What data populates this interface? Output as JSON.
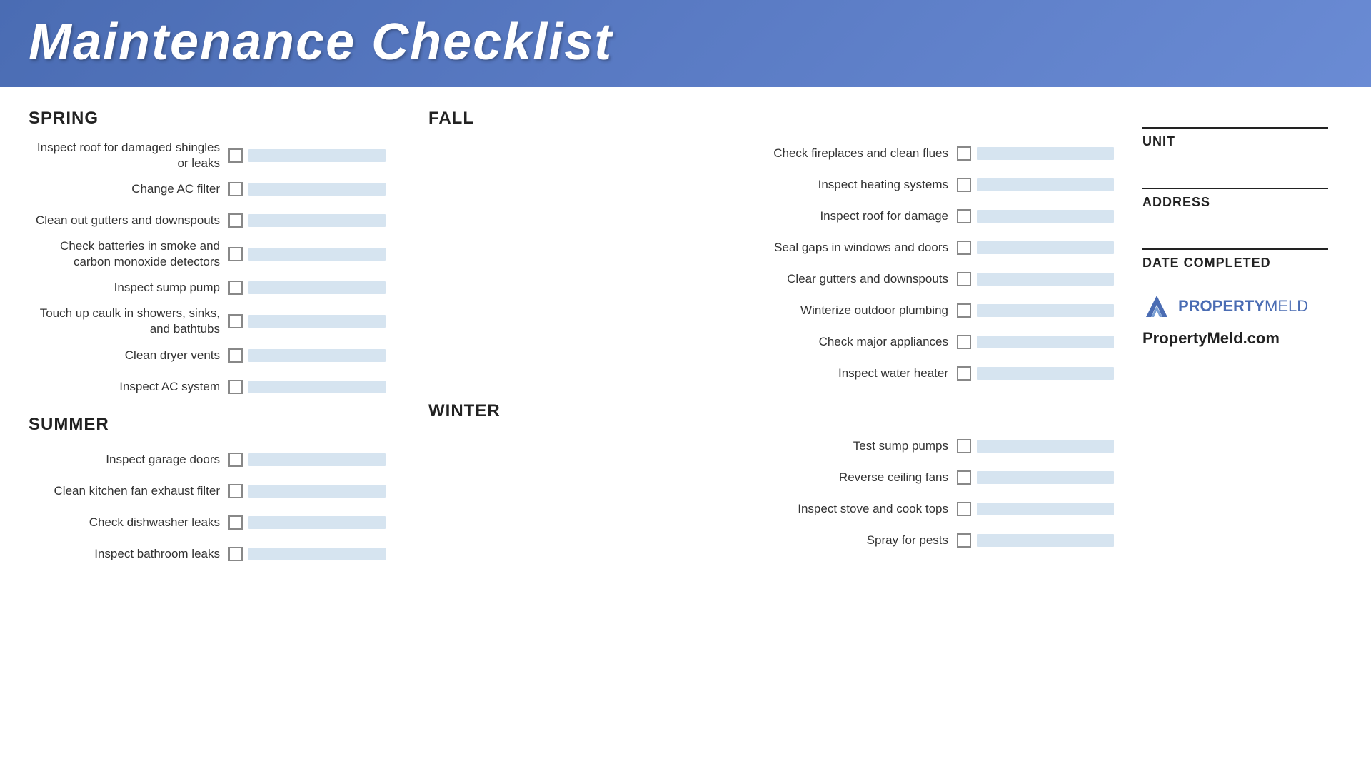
{
  "header": {
    "title": "Maintenance Checklist"
  },
  "spring": {
    "section_title": "SPRING",
    "items": [
      "Inspect roof for damaged shingles or leaks",
      "Change AC filter",
      "Clean out gutters and downspouts",
      "Check batteries in smoke and carbon monoxide detectors",
      "Inspect sump pump",
      "Touch up caulk in showers, sinks, and bathtubs",
      "Clean dryer vents",
      "Inspect AC system"
    ]
  },
  "summer": {
    "section_title": "SUMMER",
    "items": [
      "Inspect garage doors",
      "Clean kitchen fan exhaust filter",
      "Check dishwasher leaks",
      "Inspect bathroom leaks"
    ]
  },
  "fall": {
    "section_title": "FALL",
    "items": [
      "Check fireplaces and clean flues",
      "Inspect heating systems",
      "Inspect roof for damage",
      "Seal gaps in windows and doors",
      "Clear gutters and downspouts",
      "Winterize outdoor plumbing",
      "Check major appliances",
      "Inspect water heater"
    ]
  },
  "winter": {
    "section_title": "WINTER",
    "items": [
      "Test sump pumps",
      "Reverse ceiling fans",
      "Inspect stove and cook tops",
      "Spray for pests"
    ]
  },
  "form": {
    "unit_label": "UNIT",
    "address_label": "ADDRESS",
    "date_label": "DATE COMPLETED"
  },
  "branding": {
    "logo_text_part1": "PROPERTY",
    "logo_text_part2": "MELD",
    "website": "PropertyMeld.com"
  }
}
